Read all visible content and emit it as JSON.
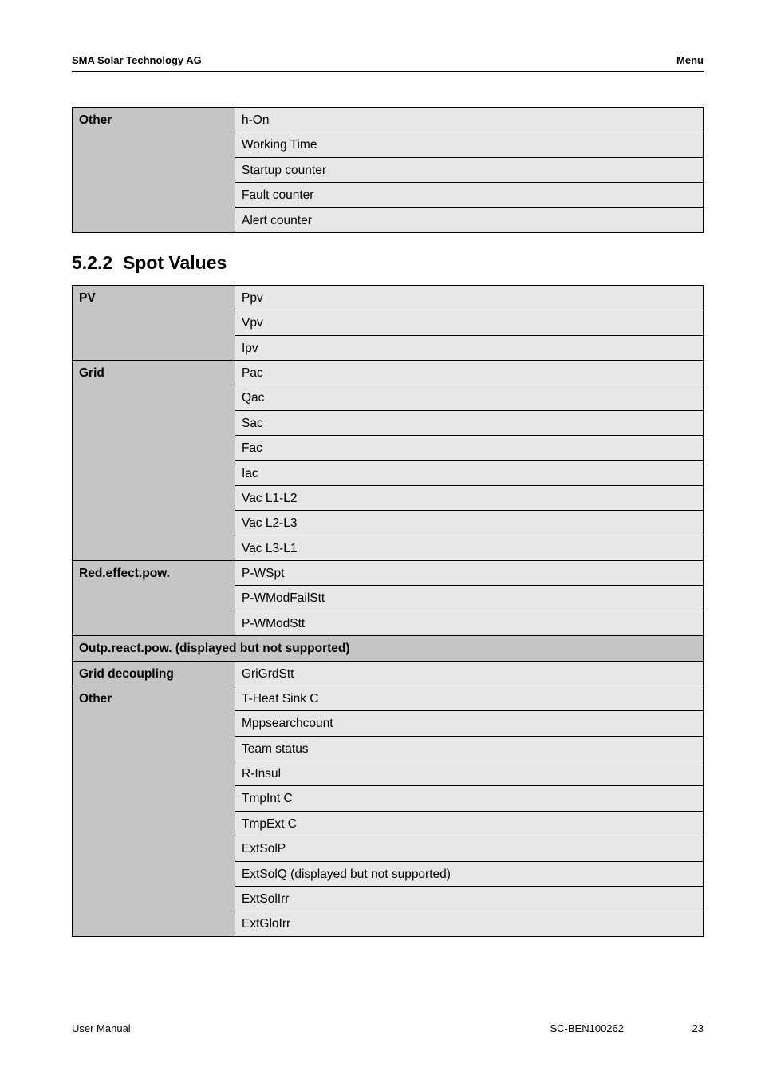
{
  "header": {
    "company": "SMA Solar Technology AG",
    "page_label": "Menu"
  },
  "table1": {
    "category": "Other",
    "rows": [
      "h-On",
      "Working Time",
      "Startup counter",
      "Fault counter",
      "Alert counter"
    ]
  },
  "section": {
    "number": "5.2.2",
    "title": "Spot Values"
  },
  "table2": {
    "groups": [
      {
        "category": "PV",
        "rows": [
          "Ppv",
          "Vpv",
          "Ipv"
        ]
      },
      {
        "category": "Grid",
        "rows": [
          "Pac",
          "Qac",
          "Sac",
          "Fac",
          "Iac",
          "Vac L1-L2",
          "Vac L2-L3",
          "Vac L3-L1"
        ]
      },
      {
        "category": "Red.effect.pow.",
        "rows": [
          "P-WSpt",
          "P-WModFailStt",
          "P-WModStt"
        ]
      }
    ],
    "spanning_row": "Outp.react.pow. (displayed but not supported)",
    "groups_after": [
      {
        "category": "Grid decoupling",
        "rows": [
          "GriGrdStt"
        ]
      },
      {
        "category": "Other",
        "rows": [
          "T-Heat Sink C",
          "Mppsearchcount",
          "Team status",
          "R-Insul",
          "TmpInt C",
          "TmpExt C",
          "ExtSolP",
          "ExtSolQ (displayed but not supported)",
          "ExtSolIrr",
          "ExtGloIrr"
        ]
      }
    ]
  },
  "footer": {
    "left": "User Manual",
    "center": "SC-BEN100262",
    "right": "23"
  }
}
